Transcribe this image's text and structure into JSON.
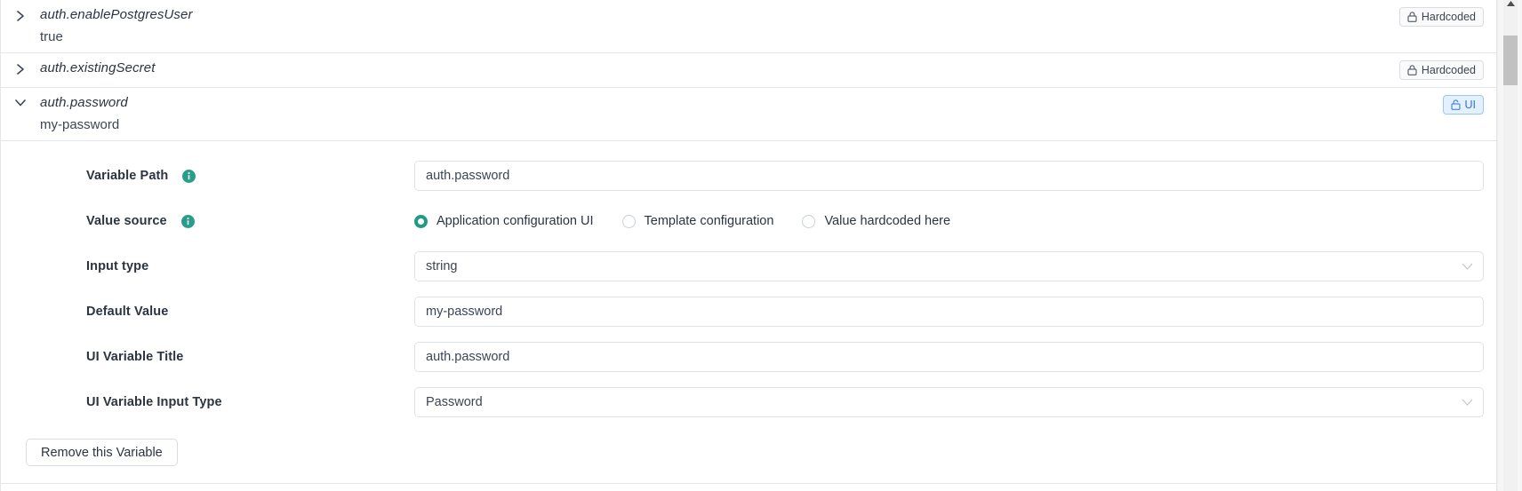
{
  "variables": [
    {
      "key": "auth.enablePostgresUser",
      "value": "true",
      "expanded": false,
      "chevron_icon": "chevron-right-icon",
      "badge": {
        "label": "Hardcoded",
        "icon": "lock-closed-icon",
        "kind": "hardcoded"
      }
    },
    {
      "key": "auth.existingSecret",
      "value": "",
      "expanded": false,
      "chevron_icon": "chevron-right-icon",
      "badge": {
        "label": "Hardcoded",
        "icon": "lock-closed-icon",
        "kind": "hardcoded"
      }
    },
    {
      "key": "auth.password",
      "value": "my-password",
      "expanded": true,
      "chevron_icon": "chevron-down-icon",
      "badge": {
        "label": "UI",
        "icon": "lock-open-icon",
        "kind": "ui"
      }
    }
  ],
  "detail": {
    "variable_path": {
      "label": "Variable Path",
      "info_icon": "info-icon",
      "value": "auth.password",
      "placeholder": "auth.password"
    },
    "value_source": {
      "label": "Value source",
      "info_icon": "info-icon",
      "selected": "Application configuration UI",
      "options": [
        "Application configuration UI",
        "Template configuration",
        "Value hardcoded here"
      ]
    },
    "input_type": {
      "label": "Input type",
      "value": "string",
      "caret_icon": "chevron-down-icon"
    },
    "default_value": {
      "label": "Default Value",
      "value": "my-password",
      "placeholder": "my-password"
    },
    "ui_variable_title": {
      "label": "UI Variable Title",
      "value": "auth.password",
      "placeholder": "auth.password"
    },
    "ui_variable_input_type": {
      "label": "UI Variable Input Type",
      "value": "Password",
      "caret_icon": "chevron-down-icon"
    },
    "remove_button": {
      "label": "Remove this Variable"
    }
  },
  "scrollbar": {
    "up_arrow_icon": "triangle-up-icon",
    "thumb_name": "scrollbar-thumb"
  },
  "colors": {
    "accent_teal": "#1f9c83",
    "badge_ui_text": "#2f73d0",
    "badge_ui_bg": "#e3f0fd",
    "border": "#e3e6ea",
    "text": "#2b3440"
  }
}
